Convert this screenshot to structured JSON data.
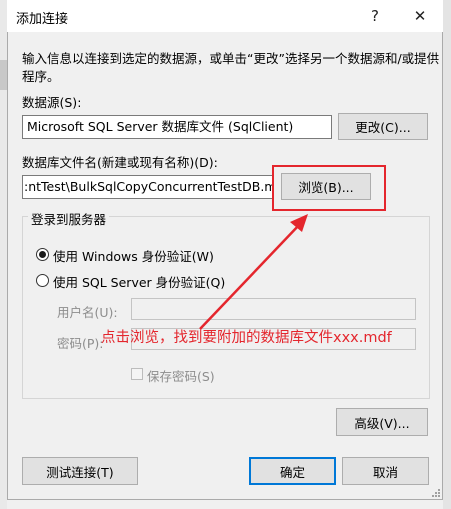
{
  "window": {
    "title": "添加连接",
    "help_symbol": "?",
    "close_symbol": "✕"
  },
  "intro": "输入信息以连接到选定的数据源，或单击“更改”选择另一个数据源和/或提供程序。",
  "intro_line1": "输入信息以连接到选定的数据源，或单击“更改”选择另一个数据源和/或提供",
  "intro_line2": "程序。",
  "datasource": {
    "label": "数据源(S):",
    "value": "Microsoft SQL Server 数据库文件 (SqlClient)",
    "change_button": "更改(C)..."
  },
  "dbfile": {
    "label": "数据库文件名(新建或现有名称)(D):",
    "value": ":ntTest\\BulkSqlCopyConcurrentTestDB.mdf",
    "browse_button": "浏览(B)..."
  },
  "login": {
    "group_title": "登录到服务器",
    "windows_auth": "使用 Windows 身份验证(W)",
    "sql_auth": "使用 SQL Server 身份验证(Q)",
    "username_label": "用户名(U):",
    "password_label": "密码(P):",
    "password_value": "",
    "save_password": "保存密码(S)",
    "selected": "windows_auth"
  },
  "annotation": "点击浏览，找到要附加的数据库文件xxx.mdf",
  "buttons": {
    "advanced": "高级(V)...",
    "test": "测试连接(T)",
    "ok": "确定",
    "cancel": "取消"
  },
  "colors": {
    "annotation_red": "#e4262d",
    "accent": "#0078d7"
  }
}
